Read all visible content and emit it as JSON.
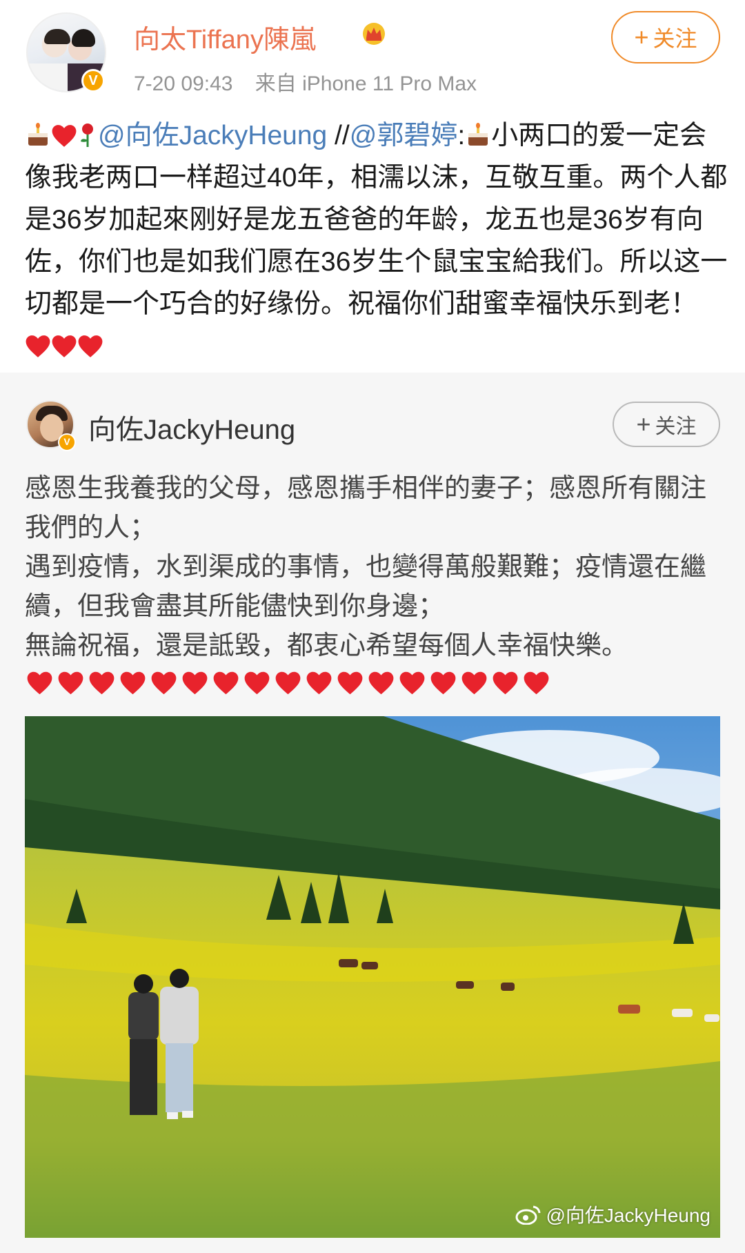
{
  "post": {
    "username": "向太Tiffany陳嵐",
    "time": "7-20 09:43",
    "source": "来自 iPhone 11 Pro Max",
    "follow_label": "关注",
    "mention_1": "@向佐JackyHeung",
    "sep": " //",
    "mention_2": "@郭碧婷",
    "colon": ":",
    "text_1": "小两口的爱一定会像我老两口一样超过40年，相濡以沫，互敬互重。两个人都是36岁加起來刚好是龙五爸爸的年龄，龙五也是36岁有向佐，你们也是如我们愿在36岁生个鼠宝宝給我们。所以这一切都是一个巧合的好缘份。祝福你们甜蜜幸福快乐到老！",
    "icons": [
      "birthday-cake-icon",
      "heart-icon",
      "rose-icon",
      "heart-icon"
    ]
  },
  "repost": {
    "username": "向佐JackyHeung",
    "follow_label": "关注",
    "lines": [
      "感恩生我養我的父母，感恩攜手相伴的妻子；感恩所有關注我們的人；",
      "遇到疫情，水到渠成的事情，也變得萬般艱難；疫情還在繼續，但我會盡其所能儘快到你身邊；",
      "無論祝福，還是詆毀，都衷心希望每個人幸福快樂。"
    ],
    "heart_count": 17,
    "photo_watermark": "@向佐JackyHeung"
  },
  "colors": {
    "username_orange": "#eb7350",
    "follow_orange": "#f08a28",
    "mention_blue": "#4a7db8",
    "heart_red": "#e8232c",
    "verified_gold": "#f7a400"
  }
}
